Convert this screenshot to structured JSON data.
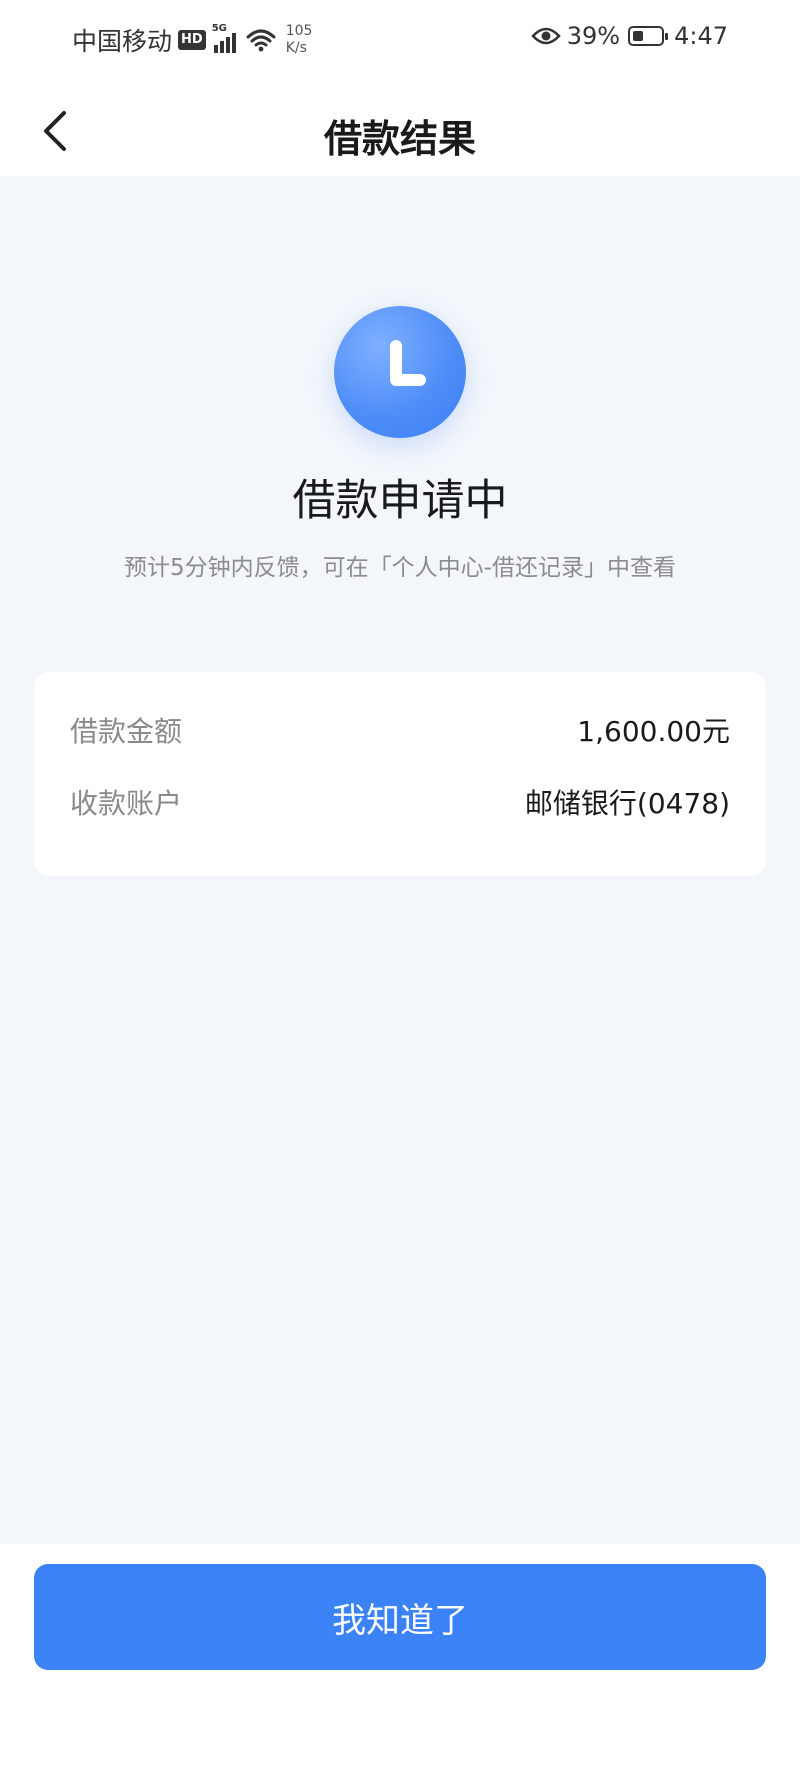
{
  "status_bar": {
    "carrier": "中国移动",
    "hd_badge": "HD",
    "network": "5G",
    "speed_value": "105",
    "speed_unit": "K/s",
    "battery_percent": "39%",
    "time": "4:47"
  },
  "nav": {
    "title": "借款结果"
  },
  "status": {
    "title": "借款申请中",
    "note": "预计5分钟内反馈，可在「个人中心-借还记录」中查看"
  },
  "details": [
    {
      "label": "借款金额",
      "value": "1,600.00元"
    },
    {
      "label": "收款账户",
      "value": "邮储银行(0478)"
    }
  ],
  "footer": {
    "button_label": "我知道了"
  },
  "colors": {
    "accent": "#3b82f6",
    "background": "#f3f6fb"
  }
}
